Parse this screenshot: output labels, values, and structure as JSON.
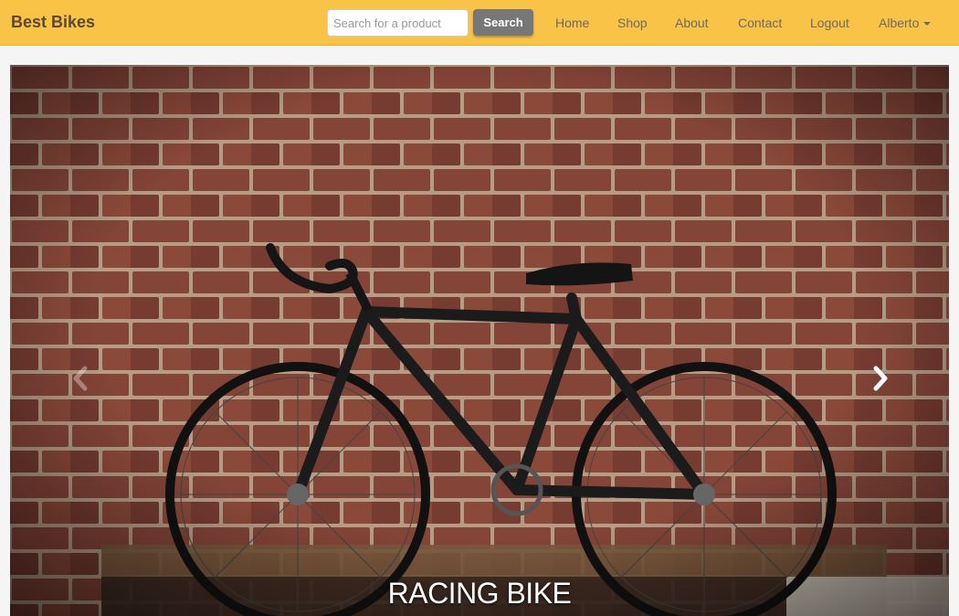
{
  "navbar": {
    "brand": "Best Bikes",
    "search_placeholder": "Search for a product",
    "search_value": "",
    "search_button": "Search",
    "links": {
      "home": "Home",
      "shop": "Shop",
      "about": "About",
      "contact": "Contact",
      "logout": "Logout"
    },
    "user": "Alberto"
  },
  "carousel": {
    "caption": "RACING BIKE",
    "image": "bicycle-against-brick-wall-photo",
    "prev_icon": "chevron-left-icon",
    "next_icon": "chevron-right-icon"
  },
  "colors": {
    "navbar_bg": "#f8c347",
    "button_bg": "#777777",
    "nav_text": "#6e6a63"
  }
}
